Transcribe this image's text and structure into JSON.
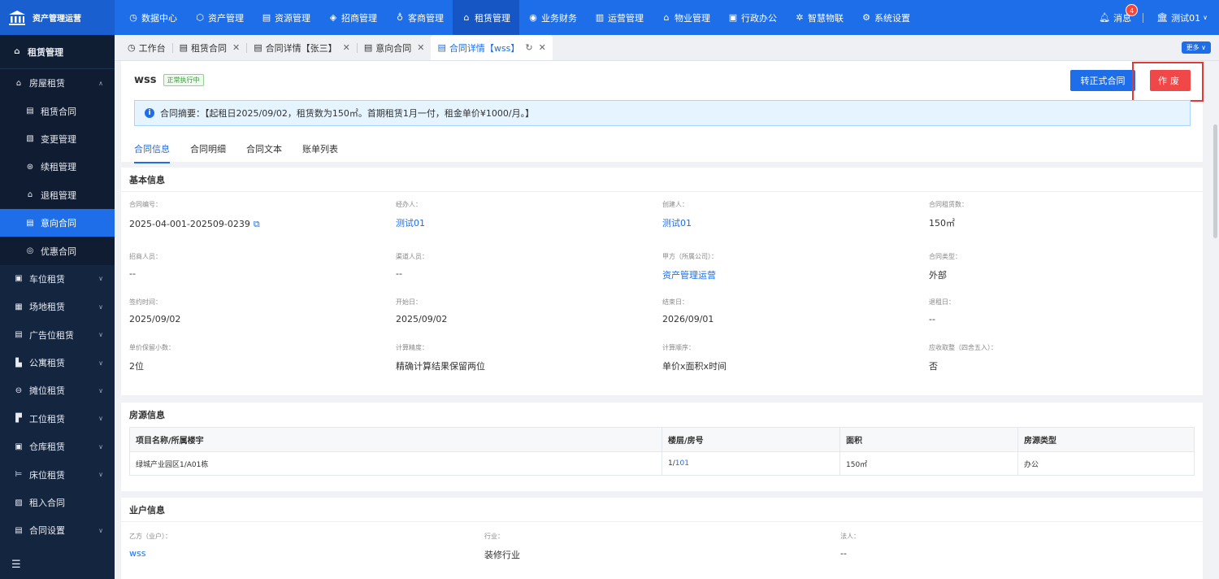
{
  "app": {
    "title": "资产管理运营"
  },
  "topnav": [
    {
      "icon": "◷",
      "label": "数据中心"
    },
    {
      "icon": "⬡",
      "label": "资产管理"
    },
    {
      "icon": "▤",
      "label": "资源管理"
    },
    {
      "icon": "◈",
      "label": "招商管理"
    },
    {
      "icon": "♁",
      "label": "客商管理"
    },
    {
      "icon": "⌂",
      "label": "租赁管理"
    },
    {
      "icon": "◉",
      "label": "业务财务"
    },
    {
      "icon": "▥",
      "label": "运营管理"
    },
    {
      "icon": "⌂",
      "label": "物业管理"
    },
    {
      "icon": "▣",
      "label": "行政办公"
    },
    {
      "icon": "✲",
      "label": "智慧物联"
    },
    {
      "icon": "⚙",
      "label": "系统设置"
    }
  ],
  "header": {
    "messages_label": "消息",
    "messages_count": "4",
    "user": "测试01"
  },
  "sidebar": {
    "title": "租赁管理",
    "group": "房屋租赁",
    "sub_items": [
      {
        "icon": "▤",
        "label": "租赁合同"
      },
      {
        "icon": "▧",
        "label": "变更管理"
      },
      {
        "icon": "⊛",
        "label": "续租管理"
      },
      {
        "icon": "⌂",
        "label": "退租管理"
      },
      {
        "icon": "▤",
        "label": "意向合同"
      },
      {
        "icon": "◎",
        "label": "优惠合同"
      }
    ],
    "items": [
      {
        "icon": "▣",
        "label": "车位租赁"
      },
      {
        "icon": "▦",
        "label": "场地租赁"
      },
      {
        "icon": "▤",
        "label": "广告位租赁"
      },
      {
        "icon": "▙",
        "label": "公寓租赁"
      },
      {
        "icon": "⊖",
        "label": "摊位租赁"
      },
      {
        "icon": "▛",
        "label": "工位租赁"
      },
      {
        "icon": "▣",
        "label": "仓库租赁"
      },
      {
        "icon": "⊨",
        "label": "床位租赁"
      },
      {
        "icon": "▨",
        "label": "租入合同"
      },
      {
        "icon": "▤",
        "label": "合同设置"
      }
    ]
  },
  "tabs": [
    {
      "icon": "◷",
      "label": "工作台"
    },
    {
      "icon": "▤",
      "label": "租赁合同"
    },
    {
      "icon": "▤",
      "label": "合同详情【张三】"
    },
    {
      "icon": "▤",
      "label": "意向合同"
    },
    {
      "icon": "▤",
      "label": "合同详情【wss】"
    }
  ],
  "tabs_more": "更多",
  "contract": {
    "name": "wss",
    "status": "正常执行中",
    "convert_btn": "转正式合同",
    "void_btn": "作废",
    "summary": "合同摘要：【起租日2025/09/02，租赁数为150㎡。首期租赁1月一付，租金单价¥1000/月。】"
  },
  "subtabs": [
    "合同信息",
    "合同明细",
    "合同文本",
    "账单列表"
  ],
  "basic": {
    "title": "基本信息",
    "fields": [
      {
        "label": "合同编号：",
        "value": "2025-04-001-202509-0239"
      },
      {
        "label": "经办人：",
        "value": "测试01"
      },
      {
        "label": "创建人：",
        "value": "测试01"
      },
      {
        "label": "合同租赁数：",
        "value": "150㎡"
      },
      {
        "label": "招商人员：",
        "value": "--"
      },
      {
        "label": "渠道人员：",
        "value": "--"
      },
      {
        "label": "甲方（所属公司）：",
        "value": "资产管理运营"
      },
      {
        "label": "合同类型：",
        "value": "外部"
      },
      {
        "label": "签约时间：",
        "value": "2025/09/02"
      },
      {
        "label": "开始日：",
        "value": "2025/09/02"
      },
      {
        "label": "结束日：",
        "value": "2026/09/01"
      },
      {
        "label": "退租日：",
        "value": "--"
      },
      {
        "label": "单价保留小数：",
        "value": "2位"
      },
      {
        "label": "计算精度：",
        "value": "精确计算结果保留两位"
      },
      {
        "label": "计算顺序：",
        "value": "单价x面积x时间"
      },
      {
        "label": "应收取整（四舍五入）：",
        "value": "否"
      }
    ]
  },
  "room": {
    "title": "房源信息",
    "headers": [
      "项目名称/所属楼宇",
      "楼层/房号",
      "面积",
      "房源类型"
    ],
    "row": {
      "project": "绿城产业园区1/A01栋",
      "floor": "1/",
      "room": "101",
      "area": "150㎡",
      "type": "办公"
    }
  },
  "tenant": {
    "title": "业户信息",
    "fields": [
      {
        "label": "乙方（业户）：",
        "value": "wss"
      },
      {
        "label": "行业：",
        "value": "装修行业"
      },
      {
        "label": "法人：",
        "value": "--"
      }
    ]
  }
}
